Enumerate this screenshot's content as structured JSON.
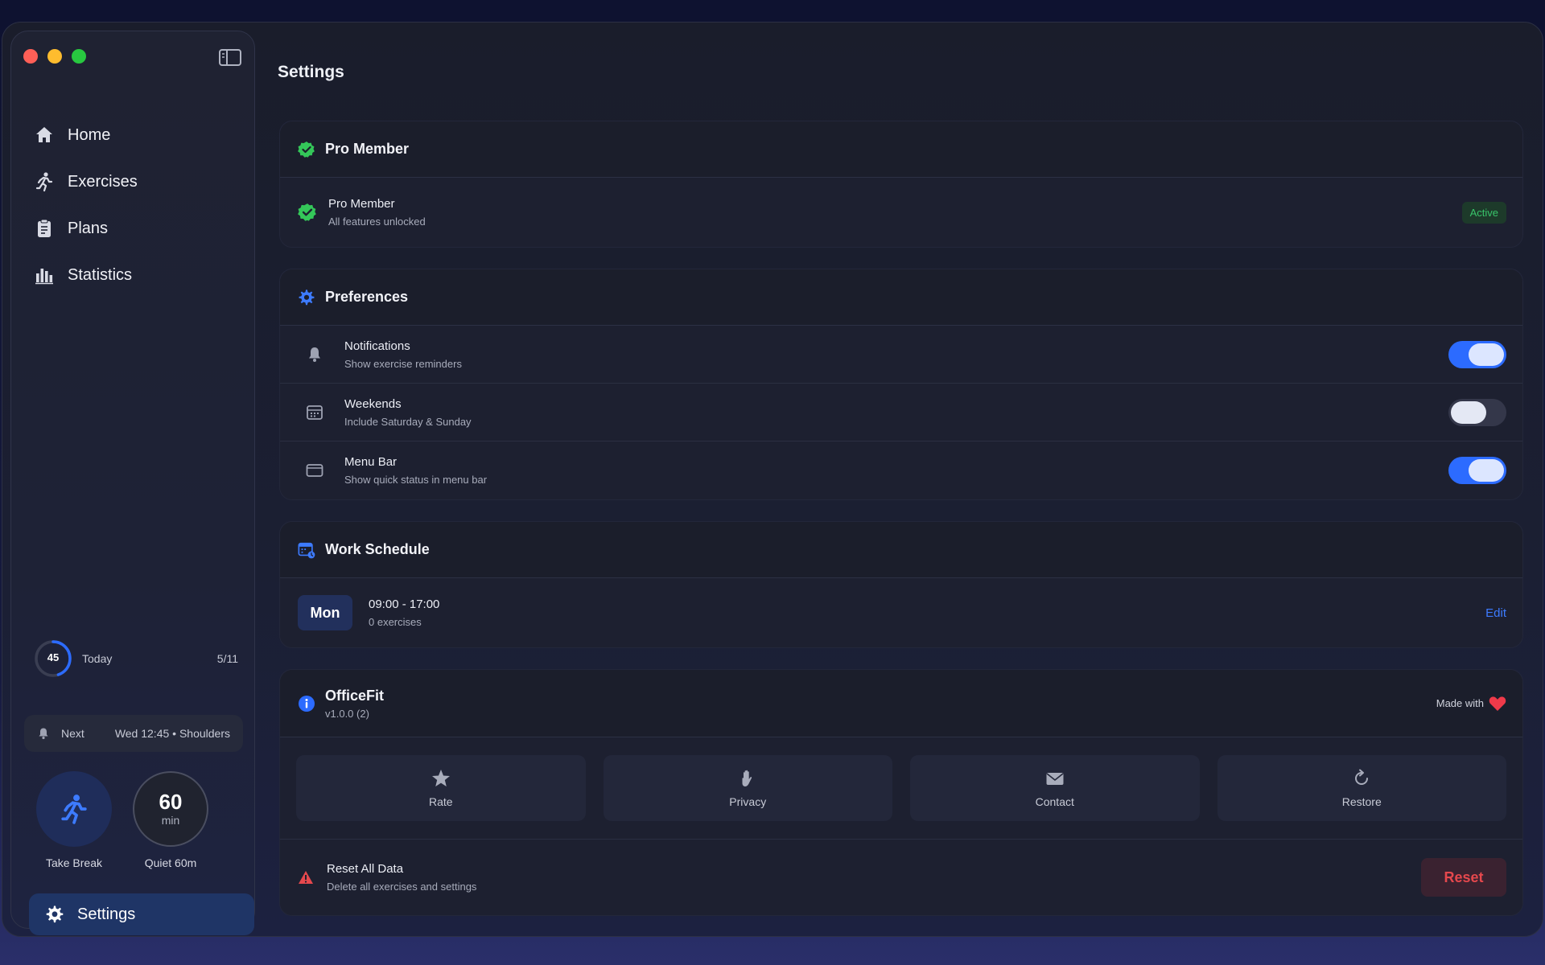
{
  "sidebar": {
    "nav": [
      {
        "label": "Home",
        "icon": "house-icon"
      },
      {
        "label": "Exercises",
        "icon": "running-figure-icon"
      },
      {
        "label": "Plans",
        "icon": "clipboard-icon"
      },
      {
        "label": "Statistics",
        "icon": "bar-chart-icon"
      }
    ],
    "today": {
      "value": "45",
      "label": "Today",
      "count": "5/11",
      "progress": 0.45
    },
    "next": {
      "label": "Next",
      "value": "Wed 12:45 • Shoulders"
    },
    "take_break": {
      "label": "Take Break"
    },
    "quiet": {
      "value": "60",
      "unit": "min",
      "label": "Quiet 60m"
    },
    "settings_label": "Settings"
  },
  "page": {
    "title": "Settings"
  },
  "pro": {
    "header": "Pro Member",
    "title": "Pro Member",
    "subtitle": "All features unlocked",
    "badge": "Active"
  },
  "preferences": {
    "header": "Preferences",
    "items": [
      {
        "title": "Notifications",
        "subtitle": "Show exercise reminders",
        "on": true
      },
      {
        "title": "Weekends",
        "subtitle": "Include Saturday & Sunday",
        "on": false
      },
      {
        "title": "Menu Bar",
        "subtitle": "Show quick status in menu bar",
        "on": true
      }
    ]
  },
  "schedule": {
    "header": "Work Schedule",
    "day": "Mon",
    "hours": "09:00 - 17:00",
    "exercises": "0 exercises",
    "edit": "Edit"
  },
  "about": {
    "name": "OfficeFit",
    "version": "v1.0.0 (2)",
    "made_with": "Made with",
    "actions": [
      "Rate",
      "Privacy",
      "Contact",
      "Restore"
    ],
    "reset_title": "Reset All Data",
    "reset_subtitle": "Delete all exercises and settings",
    "reset_button": "Reset"
  },
  "colors": {
    "accent": "#2c6bff",
    "success": "#39c46a",
    "danger": "#e5484d"
  }
}
